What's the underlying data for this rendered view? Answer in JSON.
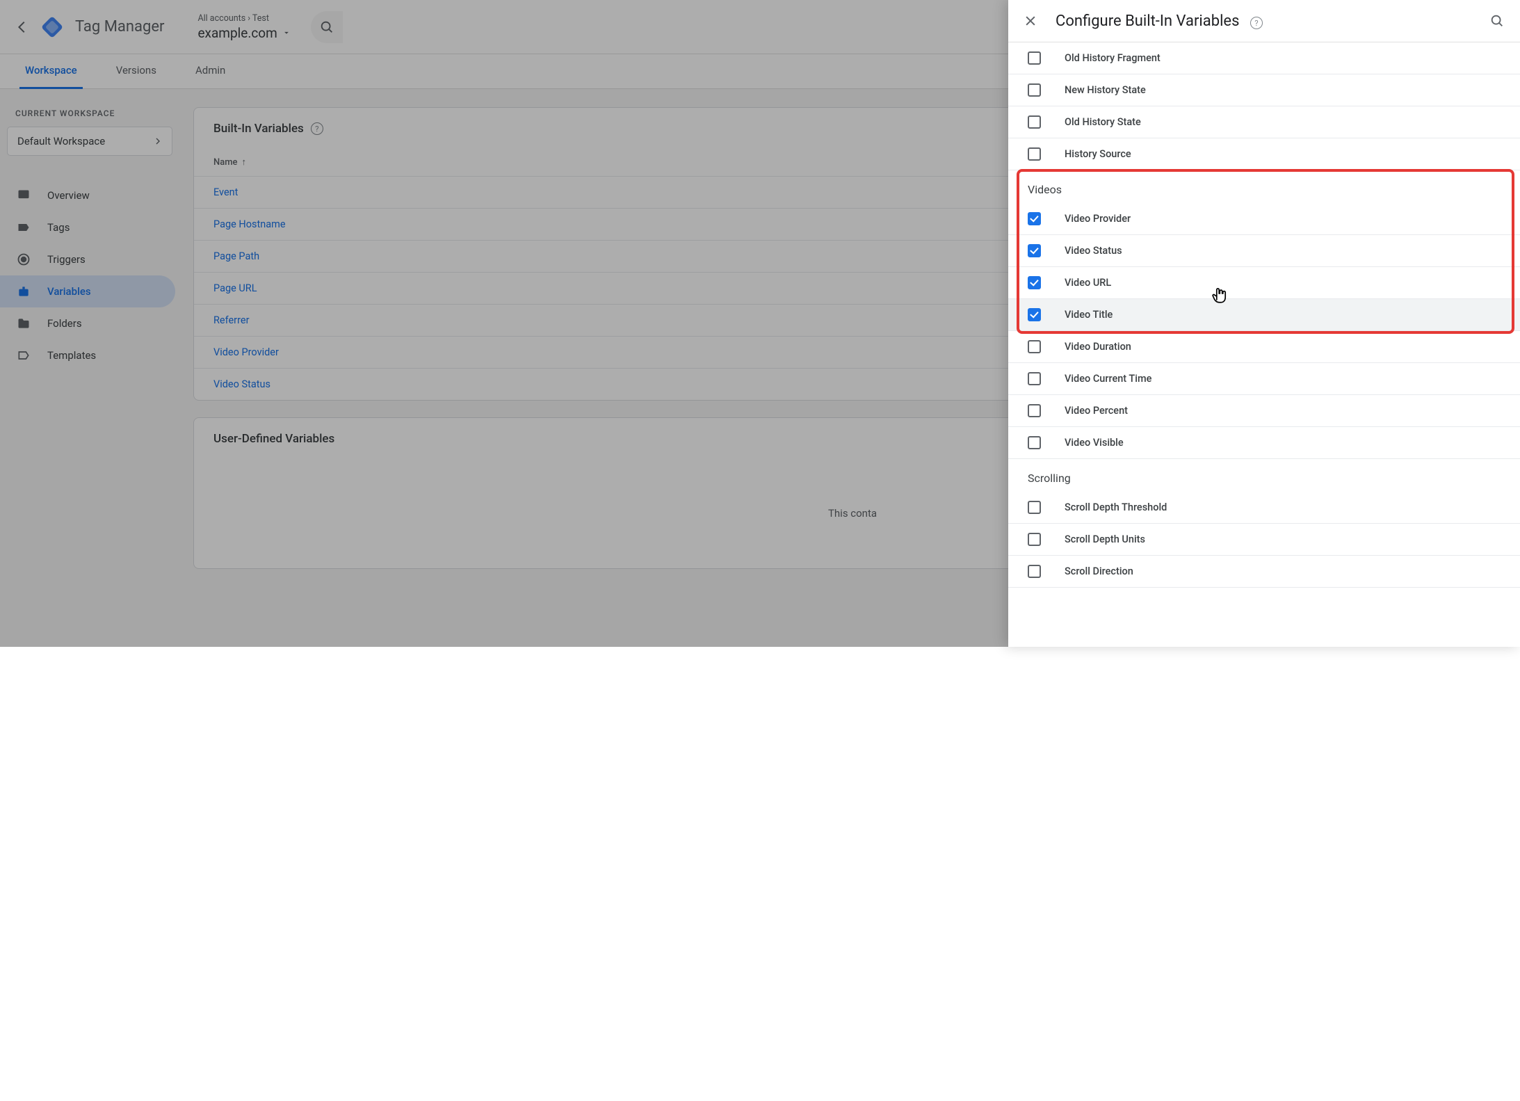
{
  "header": {
    "app_title": "Tag Manager",
    "breadcrumb_accounts": "All accounts",
    "breadcrumb_sep": "›",
    "breadcrumb_container_parent": "Test",
    "container_name": "example.com"
  },
  "tabs": [
    {
      "label": "Workspace",
      "active": true
    },
    {
      "label": "Versions",
      "active": false
    },
    {
      "label": "Admin",
      "active": false
    }
  ],
  "sidebar": {
    "current_workspace_label": "CURRENT WORKSPACE",
    "workspace_name": "Default Workspace",
    "items": [
      {
        "label": "Overview",
        "icon": "dashboard"
      },
      {
        "label": "Tags",
        "icon": "tag"
      },
      {
        "label": "Triggers",
        "icon": "target"
      },
      {
        "label": "Variables",
        "icon": "puzzle",
        "active": true
      },
      {
        "label": "Folders",
        "icon": "folder"
      },
      {
        "label": "Templates",
        "icon": "template"
      }
    ]
  },
  "builtin_card": {
    "title": "Built-In Variables",
    "column": "Name",
    "rows": [
      "Event",
      "Page Hostname",
      "Page Path",
      "Page URL",
      "Referrer",
      "Video Provider",
      "Video Status"
    ]
  },
  "userdef_card": {
    "title": "User-Defined Variables",
    "empty": "This conta"
  },
  "panel": {
    "title": "Configure Built-In Variables",
    "groups": [
      {
        "name": "",
        "items": [
          {
            "label": "Old History Fragment",
            "checked": false
          },
          {
            "label": "New History State",
            "checked": false
          },
          {
            "label": "Old History State",
            "checked": false
          },
          {
            "label": "History Source",
            "checked": false
          }
        ]
      },
      {
        "name": "Videos",
        "highlighted": true,
        "items": [
          {
            "label": "Video Provider",
            "checked": true
          },
          {
            "label": "Video Status",
            "checked": true
          },
          {
            "label": "Video URL",
            "checked": true
          },
          {
            "label": "Video Title",
            "checked": true,
            "hovered": true
          },
          {
            "label": "Video Duration",
            "checked": false
          },
          {
            "label": "Video Current Time",
            "checked": false
          },
          {
            "label": "Video Percent",
            "checked": false
          },
          {
            "label": "Video Visible",
            "checked": false
          }
        ]
      },
      {
        "name": "Scrolling",
        "items": [
          {
            "label": "Scroll Depth Threshold",
            "checked": false
          },
          {
            "label": "Scroll Depth Units",
            "checked": false
          },
          {
            "label": "Scroll Direction",
            "checked": false
          }
        ]
      }
    ]
  }
}
